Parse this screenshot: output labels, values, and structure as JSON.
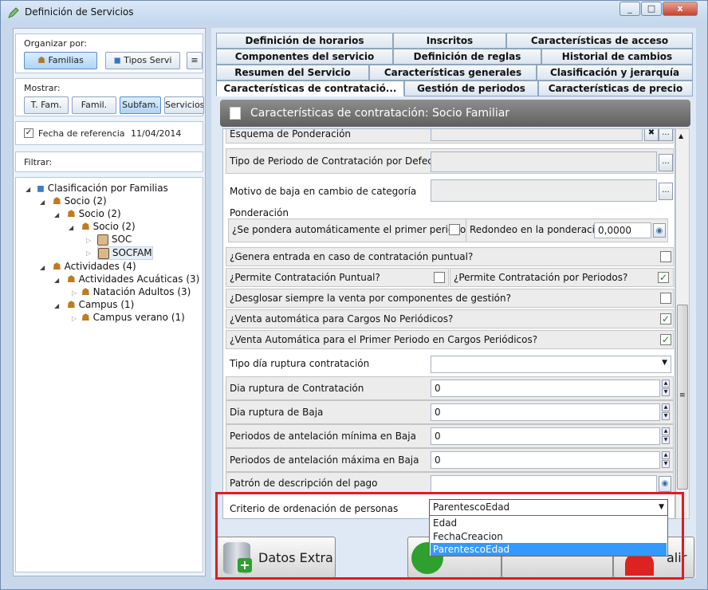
{
  "window": {
    "title": "Definición de Servicios",
    "controls": [
      "_",
      "□",
      "x"
    ]
  },
  "left": {
    "organize_label": "Organizar por:",
    "organize_buttons": [
      "Familias",
      "Tipos Servi"
    ],
    "show_label": "Mostrar:",
    "show_buttons": [
      "T. Fam.",
      "Famil.",
      "Subfam.",
      "Servicios"
    ],
    "reference_date_label": "Fecha de referencia",
    "reference_date_value": "11/04/2014",
    "filter_label": "Filtrar:",
    "tree": [
      {
        "text": "Clasificación por Familias",
        "count": ""
      },
      {
        "text": "Socio",
        "count": "(2)"
      },
      {
        "text": "Socio",
        "count": "(2)"
      },
      {
        "text": "Socio",
        "count": "(2)"
      },
      {
        "text": "SOC",
        "count": ""
      },
      {
        "text": "SOCFAM",
        "count": ""
      },
      {
        "text": "Actividades",
        "count": "(4)"
      },
      {
        "text": "Actividades Acuáticas",
        "count": "(3)"
      },
      {
        "text": "Natación Adultos",
        "count": "(3)"
      },
      {
        "text": "Campus",
        "count": "(1)"
      },
      {
        "text": "Campus verano",
        "count": "(1)"
      }
    ]
  },
  "tabs": {
    "row1": [
      "Definición de horarios",
      "Inscritos",
      "Características de acceso"
    ],
    "row2": [
      "Componentes del servicio",
      "Definición de reglas",
      "Historial de cambios"
    ],
    "row3": [
      "Resumen del Servicio",
      "Características generales",
      "Clasificación y jerarquía"
    ],
    "row4": [
      "Características de contratació...",
      "Gestión de periodos",
      "Características de precio"
    ]
  },
  "panel": {
    "header": "Características de contratación: Socio Familiar",
    "fields": {
      "esquema": "Esquema de Ponderación",
      "tipo_periodo": "Tipo de Periodo de Contratación por Defecto",
      "motivo_baja": "Motivo de baja en cambio de categoría",
      "ponderacion_group": "Ponderación",
      "pondera_primer": "¿Se pondera automáticamente el primer periodo?",
      "redondeo": "Redondeo en la ponderación",
      "redondeo_value": "0,0000",
      "genera_entrada": "¿Genera entrada en caso de contratación puntual?",
      "permite_puntual": "¿Permite Contratación Puntual?",
      "permite_periodos": "¿Permite Contratación por Periodos?",
      "desglosar": "¿Desglosar siempre la venta por componentes de gestión?",
      "venta_no_periodicos": "¿Venta automática para Cargos No Periódicos?",
      "venta_primer_periodo": "¿Venta Automática para el Primer Periodo en Cargos Periódicos?",
      "tipo_dia": "Tipo día ruptura contratación",
      "dia_ruptura_contratacion": "Dia ruptura de Contratación",
      "dia_ruptura_contratacion_value": "0",
      "dia_ruptura_baja": "Dia ruptura de Baja",
      "dia_ruptura_baja_value": "0",
      "antelacion_min": "Periodos de antelación mínima en Baja",
      "antelacion_min_value": "0",
      "antelacion_max": "Periodos de antelación máxima en Baja",
      "antelacion_max_value": "0",
      "patron": "Patrón de descripción del pago",
      "criterio": "Criterio de ordenación de personas",
      "criterio_value": "ParentescoEdad"
    },
    "checks": {
      "permite_periodos": "✓",
      "venta_no_periodicos": "✓",
      "venta_primer_periodo": "✓"
    },
    "dropdown_options": [
      "Edad",
      "FechaCreacion",
      "ParentescoEdad"
    ]
  },
  "buttons": {
    "datos_extra": "Datos Extra",
    "salir_partial": "alir"
  },
  "colors": {
    "highlight": "#e01b23",
    "selection": "#3399ff",
    "check": "#1f7a1f"
  }
}
